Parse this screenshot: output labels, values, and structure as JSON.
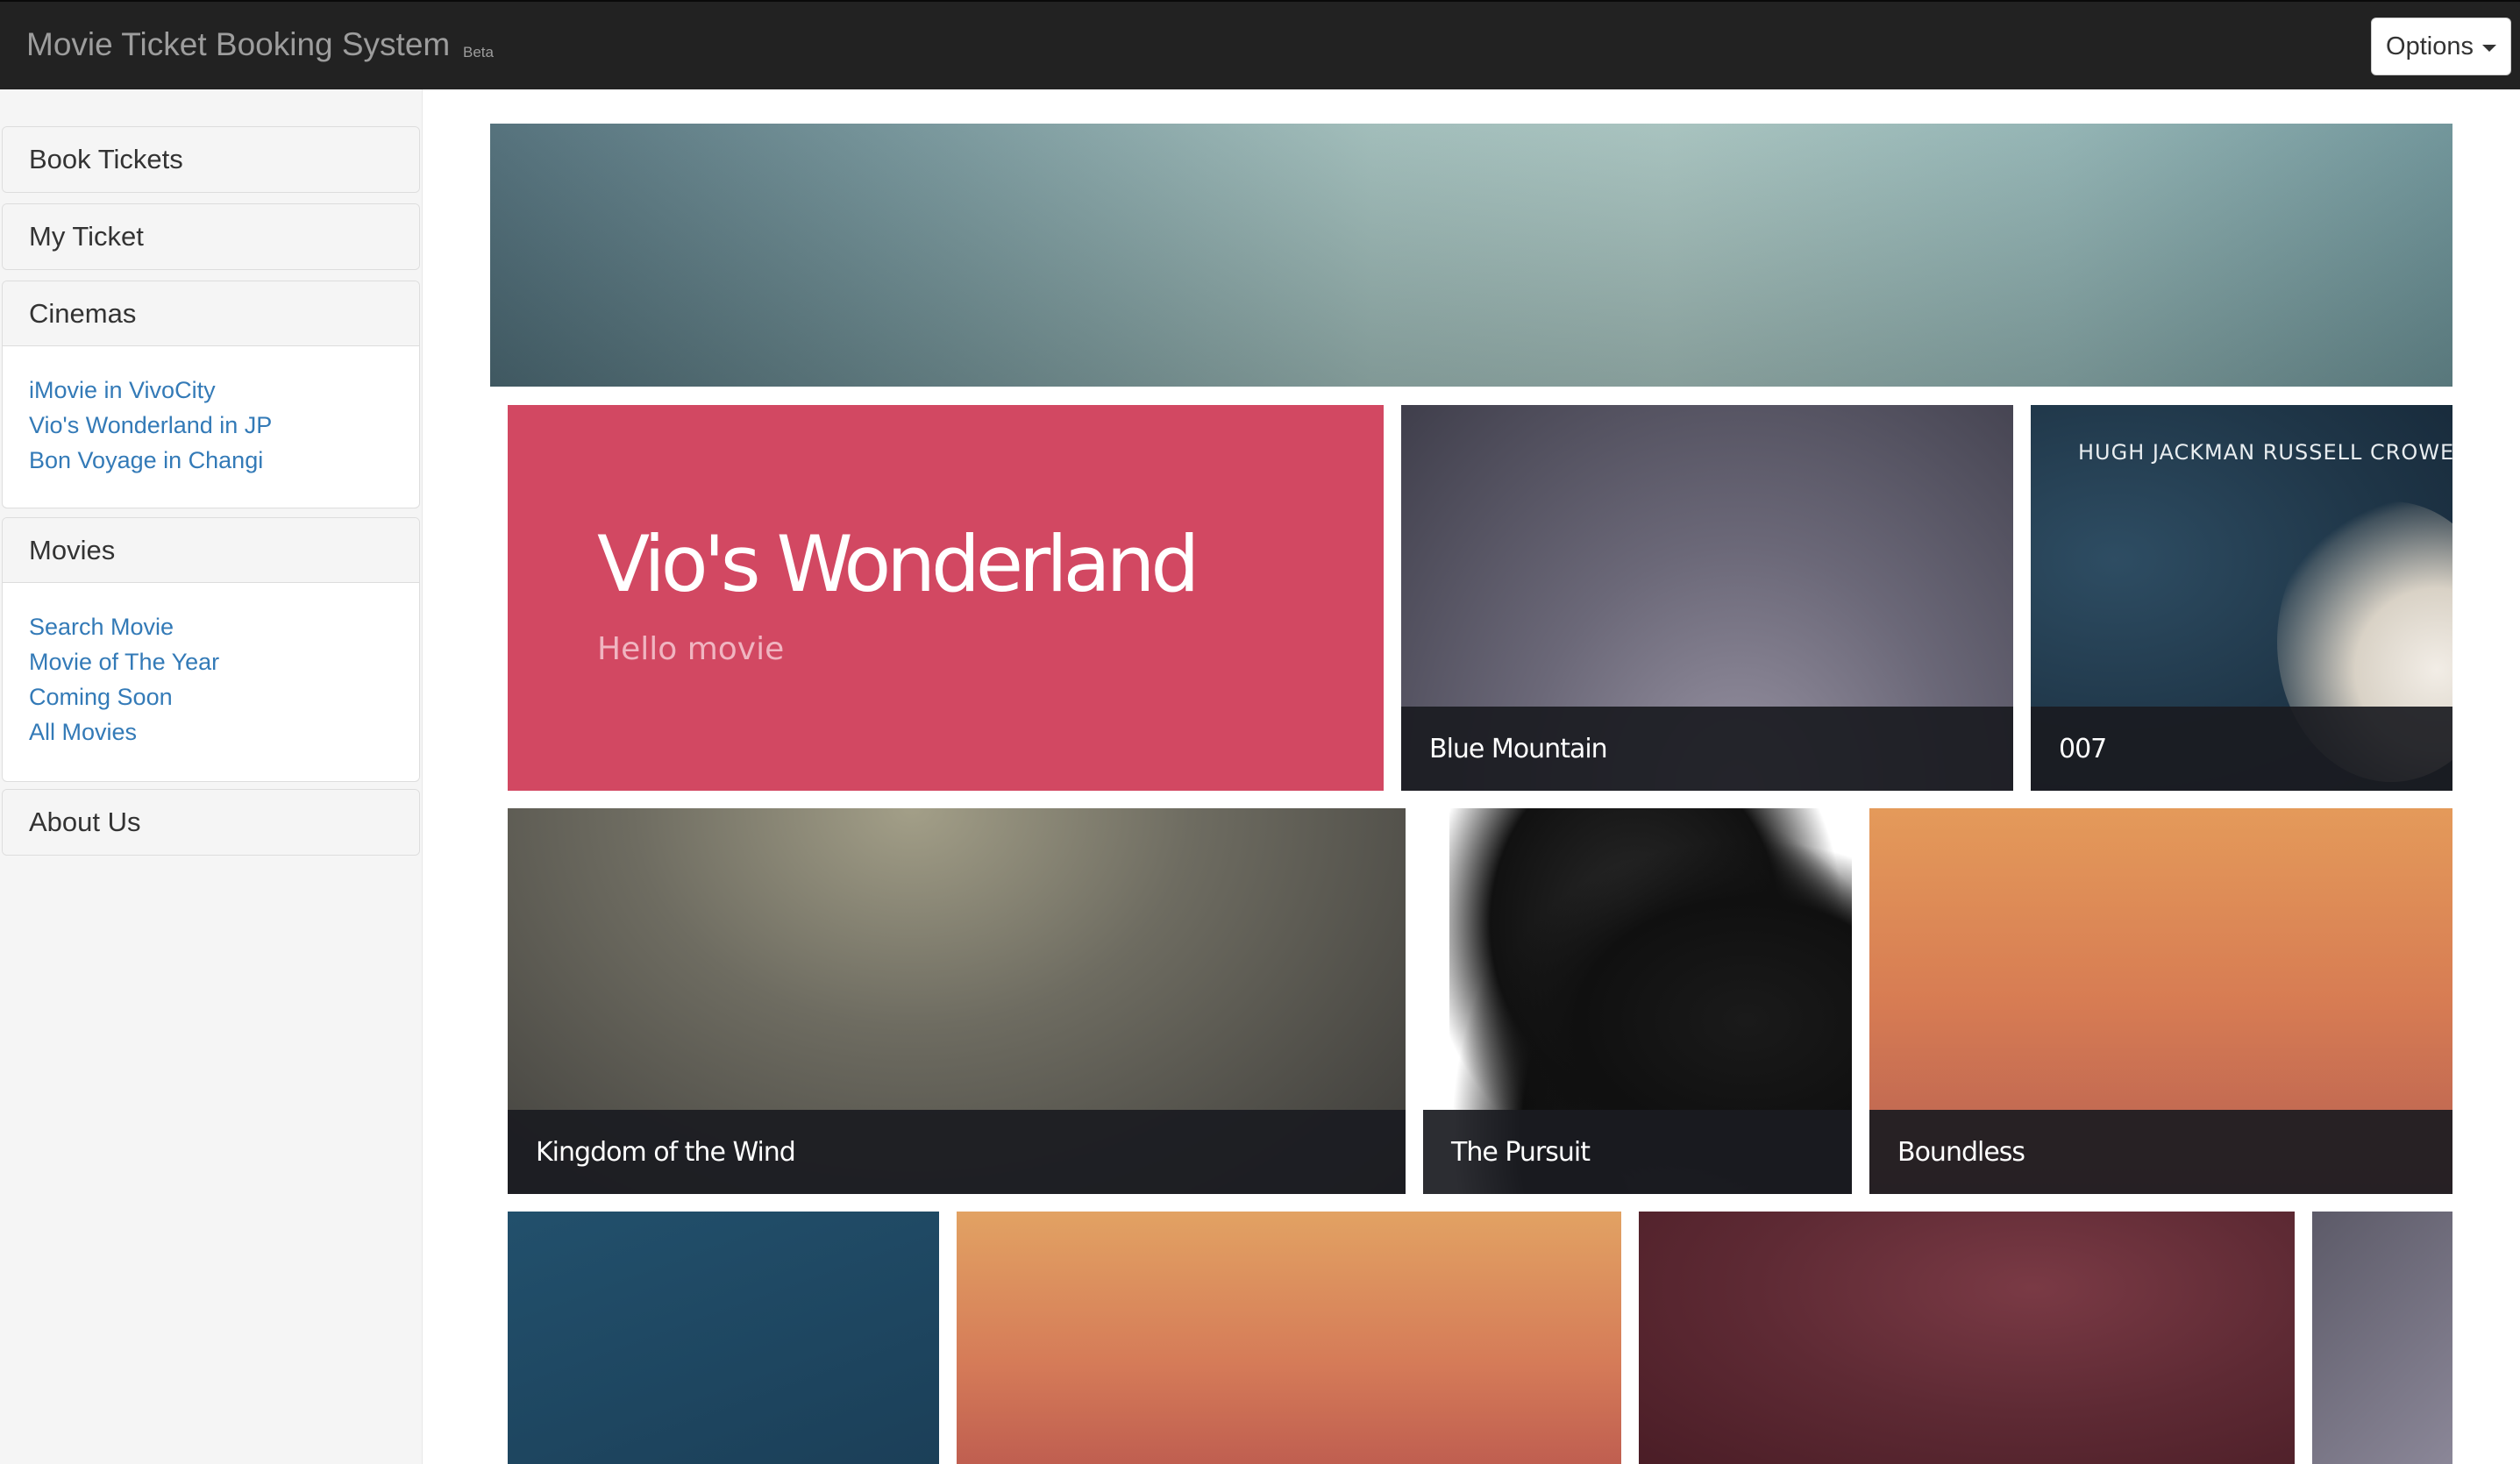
{
  "navbar": {
    "brand": "Movie Ticket Booking System",
    "badge": "Beta",
    "options_label": "Options"
  },
  "sidebar": {
    "book_tickets": "Book Tickets",
    "my_ticket": "My Ticket",
    "cinemas": {
      "title": "Cinemas",
      "links": [
        "iMovie in VivoCity",
        "Vio's Wonderland in JP",
        "Bon Voyage in Changi"
      ]
    },
    "movies": {
      "title": "Movies",
      "links": [
        "Search Movie",
        "Movie of The Year",
        "Coming Soon",
        "All Movies"
      ]
    },
    "about_us": "About Us"
  },
  "feature": {
    "title": "Vio's Wonderland",
    "subtitle": "Hello movie",
    "color": "#d24862"
  },
  "tiles": {
    "blue_mountain": "Blue Mountain",
    "t007": "007",
    "t007_cast": "HUGH JACKMAN   RUSSELL CROWE   A",
    "kingdom": "Kingdom of the Wind",
    "pursuit": "The Pursuit",
    "boundless": "Boundless"
  },
  "colors": {
    "navbar_bg": "#222222",
    "link": "#337ab7",
    "tile_label_bg": "#1a1b21"
  }
}
